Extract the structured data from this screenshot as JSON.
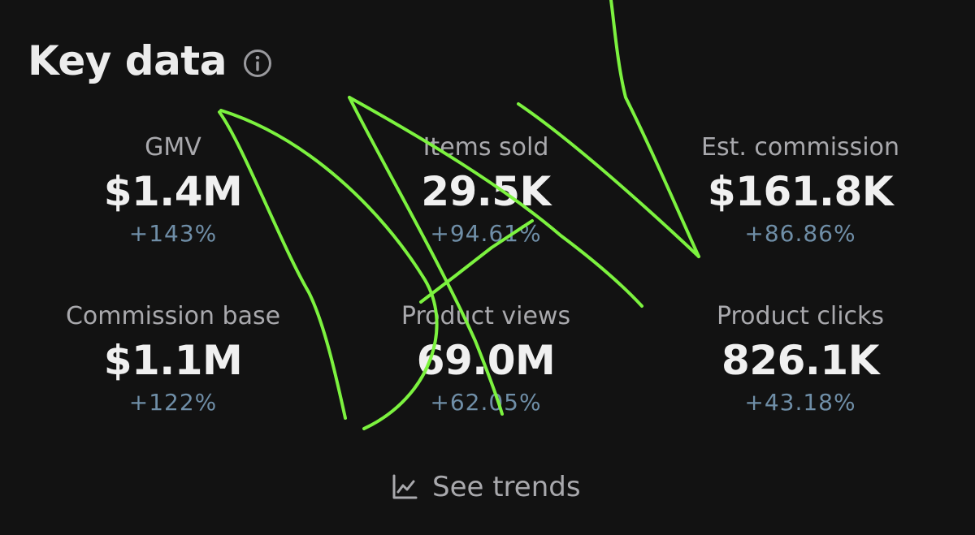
{
  "header": {
    "title": "Key data",
    "info_icon": "info-icon"
  },
  "metrics": [
    {
      "label": "GMV",
      "value": "$1.4M",
      "change": "+143%"
    },
    {
      "label": "Items sold",
      "value": "29.5K",
      "change": "+94.61%"
    },
    {
      "label": "Est. commission",
      "value": "$161.8K",
      "change": "+86.86%"
    },
    {
      "label": "Commission base",
      "value": "$1.1M",
      "change": "+122%"
    },
    {
      "label": "Product views",
      "value": "69.0M",
      "change": "+62.05%"
    },
    {
      "label": "Product clicks",
      "value": "826.1K",
      "change": "+43.18%"
    }
  ],
  "footer": {
    "see_trends_label": "See trends",
    "trend_icon": "line-chart-icon"
  },
  "colors": {
    "background": "#121212",
    "positive_change": "#6f8ea7",
    "label": "#a9a9ad",
    "value": "#f0f0f0",
    "annotation_stroke": "#7cf23f"
  }
}
